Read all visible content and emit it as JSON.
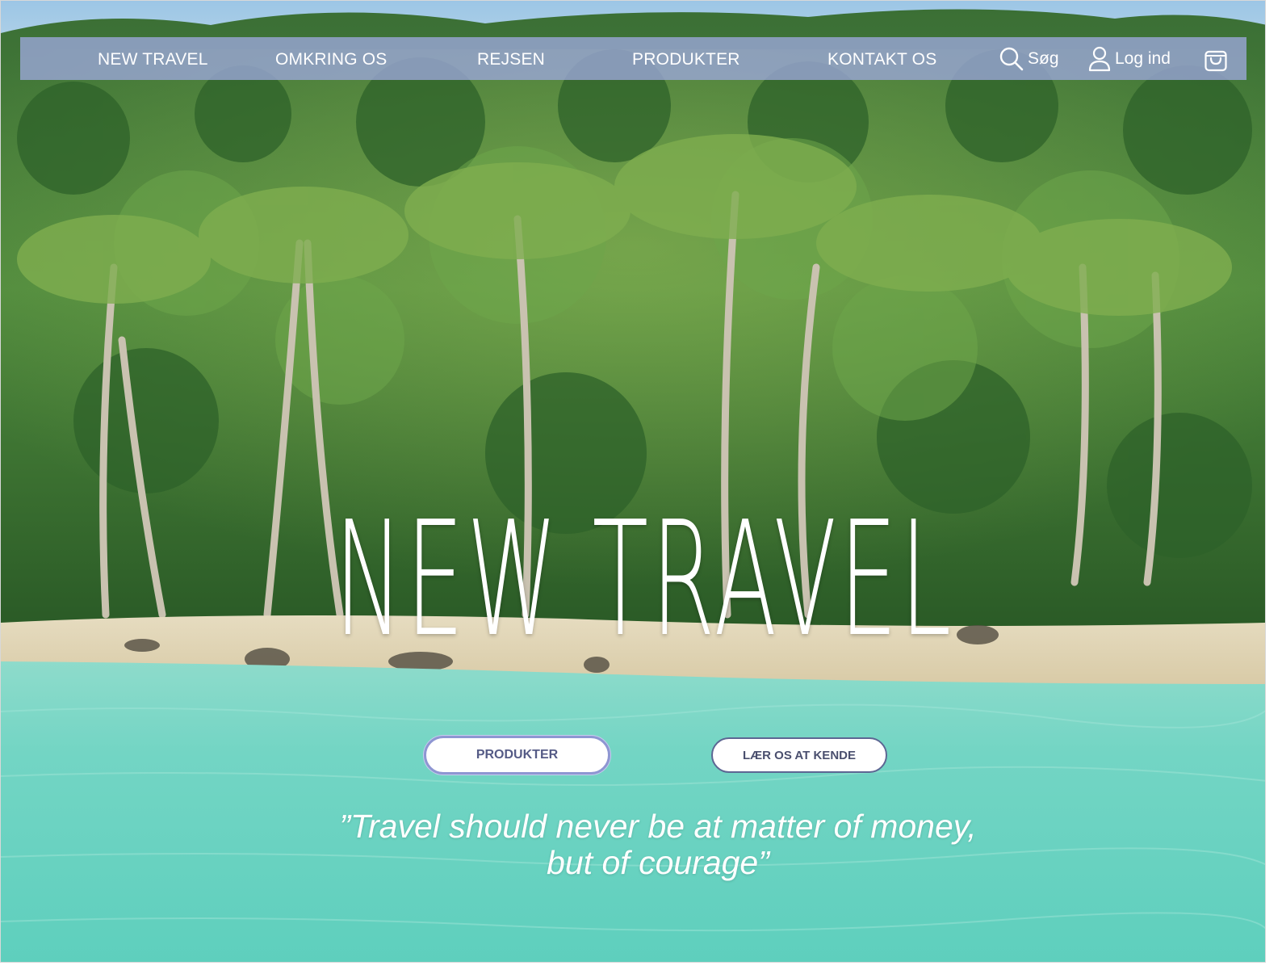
{
  "nav": {
    "links": [
      {
        "label": "NEW TRAVEL"
      },
      {
        "label": "OMKRING OS"
      },
      {
        "label": "REJSEN"
      },
      {
        "label": "PRODUKTER"
      },
      {
        "label": "KONTAKT OS"
      }
    ],
    "search_label": "Søg",
    "login_label": "Log ind",
    "icons": [
      "search-icon",
      "user-icon",
      "cart-icon"
    ]
  },
  "hero": {
    "title": "NEW TRAVEL",
    "primary_button": "PRODUKTER",
    "secondary_button": "LÆR OS AT KENDE",
    "quote_line1": "”Travel should never be at matter of money,",
    "quote_line2": "but of courage”"
  },
  "colors": {
    "nav_bg": "#9ea8dc",
    "button_text": "#555b86",
    "button_border": "#8e96d2",
    "water": "#6fd6c4",
    "foliage": "#2f6a2c"
  }
}
